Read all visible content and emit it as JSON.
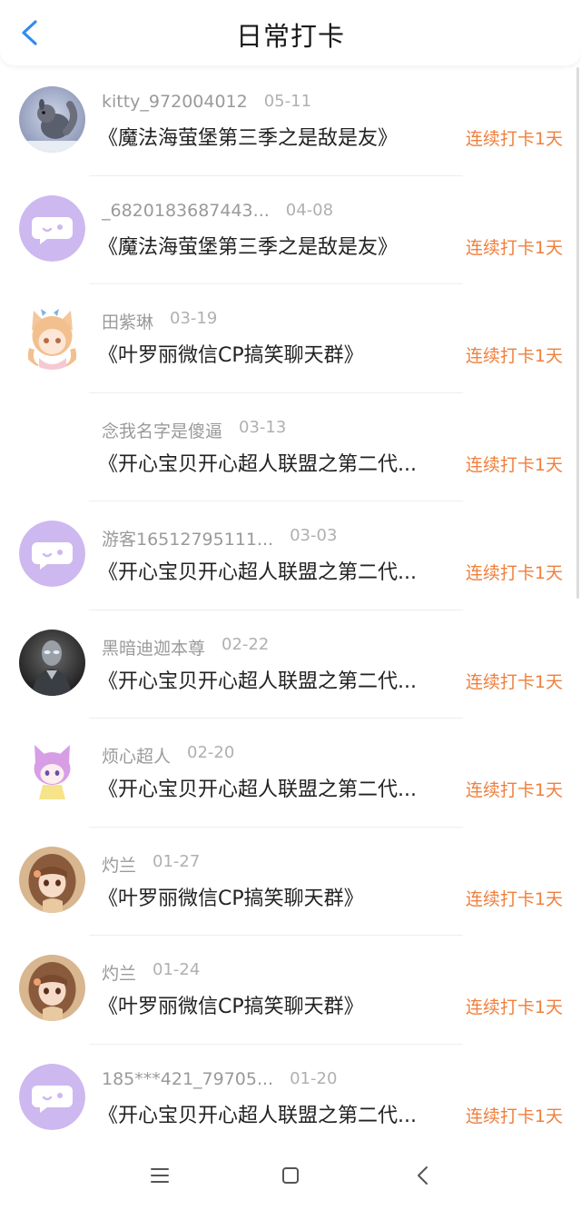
{
  "header": {
    "title": "日常打卡",
    "back_icon": "chevron-left-icon",
    "accent": "#2f8cf0"
  },
  "streak_color": "#f07f3c",
  "rows": [
    {
      "username": "kitty_972004012",
      "date": "05-11",
      "group": "《魔法海萤堡第三季之是敌是友》",
      "streak": "连续打卡1天",
      "avatar": "squirrel-photo"
    },
    {
      "username": "_6820183687443...",
      "date": "04-08",
      "group": "《魔法海萤堡第三季之是敌是友》",
      "streak": "连续打卡1天",
      "avatar": "default-chat-bubble"
    },
    {
      "username": "田紫琳",
      "date": "03-19",
      "group": "《叶罗丽微信CP搞笑聊天群》",
      "streak": "连续打卡1天",
      "avatar": "anime-cat-girl"
    },
    {
      "username": "念我名字是傻逼",
      "date": "03-13",
      "group": "《开心宝贝开心超人联盟之第二代...",
      "streak": "连续打卡1天",
      "avatar": "none"
    },
    {
      "username": "游客16512795111...",
      "date": "03-03",
      "group": "《开心宝贝开心超人联盟之第二代...",
      "streak": "连续打卡1天",
      "avatar": "default-chat-bubble"
    },
    {
      "username": "黑暗迪迦本尊",
      "date": "02-22",
      "group": "《开心宝贝开心超人联盟之第二代...",
      "streak": "连续打卡1天",
      "avatar": "dark-hero-photo"
    },
    {
      "username": "烦心超人",
      "date": "02-20",
      "group": "《开心宝贝开心超人联盟之第二代...",
      "streak": "连续打卡1天",
      "avatar": "purple-hair-chibi"
    },
    {
      "username": "灼兰",
      "date": "01-27",
      "group": "《叶罗丽微信CP搞笑聊天群》",
      "streak": "连续打卡1天",
      "avatar": "anime-girl-brown"
    },
    {
      "username": "灼兰",
      "date": "01-24",
      "group": "《叶罗丽微信CP搞笑聊天群》",
      "streak": "连续打卡1天",
      "avatar": "anime-girl-brown"
    },
    {
      "username": "185***421_79705...",
      "date": "01-20",
      "group": "《开心宝贝开心超人联盟之第二代...",
      "streak": "连续打卡1天",
      "avatar": "default-chat-bubble"
    }
  ],
  "navbar": {
    "icons": [
      "menu-icon",
      "home-square-icon",
      "back-triangle-icon"
    ]
  }
}
